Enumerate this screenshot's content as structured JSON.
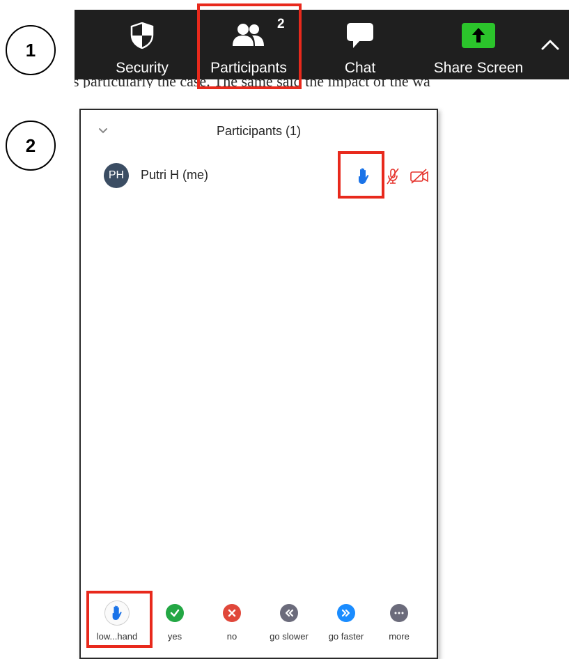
{
  "steps": {
    "one": "1",
    "two": "2"
  },
  "toolbar": {
    "security_label": "Security",
    "participants_label": "Participants",
    "participants_count": "2",
    "chat_label": "Chat",
    "share_label": "Share Screen",
    "background_color": "#1f1f1f",
    "share_icon_color": "#2bc42b"
  },
  "background_text": "s particularly the case. The same said the impact of the wa",
  "panel": {
    "title": "Participants (1)",
    "participant": {
      "initials": "PH",
      "name": "Putri H (me)",
      "avatar_color": "#3b4d63"
    },
    "status_icons": [
      "raised-hand-icon",
      "muted-mic-icon",
      "video-off-icon"
    ],
    "accent_blue": "#1a73e8",
    "status_red": "#e5322b"
  },
  "reactions": [
    {
      "label": "low...hand",
      "icon": "raised-hand-icon",
      "color": "#1a73e8"
    },
    {
      "label": "yes",
      "icon": "check-icon",
      "color": "#23a744"
    },
    {
      "label": "no",
      "icon": "x-icon",
      "color": "#e0473a"
    },
    {
      "label": "go slower",
      "icon": "rewind-icon",
      "color": "#6b6b7b"
    },
    {
      "label": "go faster",
      "icon": "fast-forward-icon",
      "color": "#1a8cff"
    },
    {
      "label": "more",
      "icon": "ellipsis-icon",
      "color": "#6b6b7b"
    }
  ],
  "highlight_color": "#e8291c"
}
